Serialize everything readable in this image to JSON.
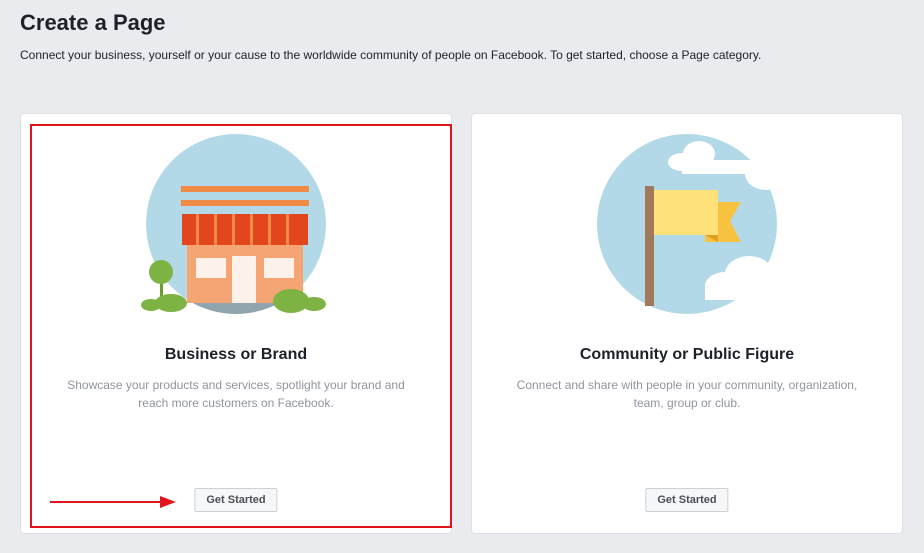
{
  "page": {
    "title": "Create a Page",
    "subtitle": "Connect your business, yourself or your cause to the worldwide community of people on Facebook. To get started, choose a Page category."
  },
  "cards": [
    {
      "title": "Business or Brand",
      "description": "Showcase your products and services, spotlight your brand and reach more customers on Facebook.",
      "button_label": "Get Started",
      "icon": "storefront-icon",
      "highlighted": true
    },
    {
      "title": "Community or Public Figure",
      "description": "Connect and share with people in your community, organization, team, group or club.",
      "button_label": "Get Started",
      "icon": "flag-icon",
      "highlighted": false
    }
  ],
  "annotation": {
    "highlight_color": "#e0141b",
    "arrow_icon": "right-arrow-icon"
  },
  "colors": {
    "background": "#e9ebee",
    "card": "#ffffff",
    "title_text": "#1d2129",
    "muted_text": "#90949c",
    "circle": "#b3d8e8"
  }
}
